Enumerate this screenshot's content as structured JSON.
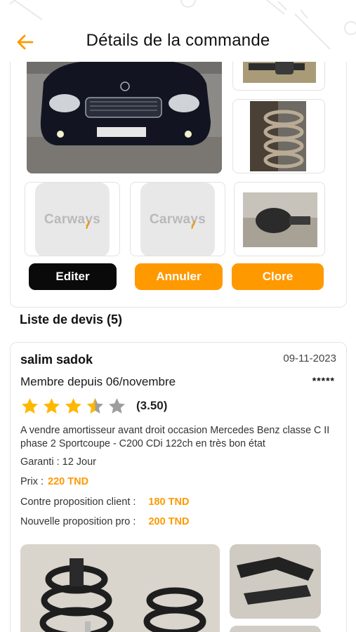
{
  "header": {
    "title": "Détails de la commande",
    "back_icon": "arrow-left-icon",
    "accent": "#ff9900"
  },
  "order": {
    "placeholder_brand": "Carways",
    "buttons": {
      "edit": "Editer",
      "cancel": "Annuler",
      "close": "Clore"
    }
  },
  "quotes": {
    "heading": "Liste de devis (5)",
    "items": [
      {
        "name": "salim sadok",
        "date": "09-11-2023",
        "member_since": "Membre depuis 06/novembre",
        "masked": "*****",
        "rating": 3.5,
        "rating_label": "(3.50)",
        "description": "A vendre amortisseur avant droit occasion Mercedes Benz classe C II phase 2 Sportcoupe - C200 CDi 122ch en très bon état",
        "warranty": "Garanti : 12 Jour",
        "price_label": "Prix :",
        "price": "220 TND",
        "counter_client_label": "Contre proposition client :",
        "counter_client": "180 TND",
        "counter_pro_label": "Nouvelle proposition pro :",
        "counter_pro": "200 TND"
      }
    ]
  }
}
